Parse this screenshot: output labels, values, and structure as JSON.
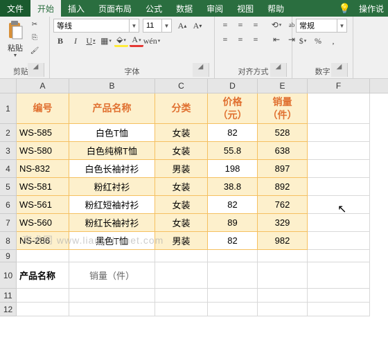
{
  "menus": {
    "file": "文件",
    "home": "开始",
    "insert": "插入",
    "layout": "页面布局",
    "formulas": "公式",
    "data": "数据",
    "review": "审阅",
    "view": "视图",
    "help": "帮助",
    "operate": "操作说"
  },
  "ribbon": {
    "clipboard": {
      "paste": "粘贴",
      "label": "剪贴板"
    },
    "font": {
      "name": "等线",
      "size": "11",
      "label": "字体",
      "wen": "wén"
    },
    "align": {
      "label": "对齐方式",
      "ab": "ab",
      "wrap": "↵"
    },
    "number": {
      "format": "常规",
      "label": "数字"
    }
  },
  "cols": [
    "A",
    "B",
    "C",
    "D",
    "E",
    "F"
  ],
  "headers": {
    "a": "编号",
    "b": "产品名称",
    "c": "分类",
    "d": "价格\n（元）",
    "e": "销量\n（件）"
  },
  "rows": [
    {
      "a": "WS-585",
      "b": "白色T恤",
      "c": "女装",
      "d": "82",
      "e": "528"
    },
    {
      "a": "WS-580",
      "b": "白色纯棉T恤",
      "c": "女装",
      "d": "55.8",
      "e": "638"
    },
    {
      "a": "NS-832",
      "b": "白色长袖衬衫",
      "c": "男装",
      "d": "198",
      "e": "897"
    },
    {
      "a": "WS-581",
      "b": "粉红衬衫",
      "c": "女装",
      "d": "38.8",
      "e": "892"
    },
    {
      "a": "WS-561",
      "b": "粉红短袖衬衫",
      "c": "女装",
      "d": "82",
      "e": "762"
    },
    {
      "a": "WS-560",
      "b": "粉红长袖衬衫",
      "c": "女装",
      "d": "89",
      "e": "329"
    },
    {
      "a": "NS-286",
      "b": "黑色T恤",
      "c": "男装",
      "d": "82",
      "e": "982"
    }
  ],
  "row10": {
    "a": "产品名称",
    "b": "销量（件）"
  },
  "watermark": "亮术网 www.liangshunet.com"
}
